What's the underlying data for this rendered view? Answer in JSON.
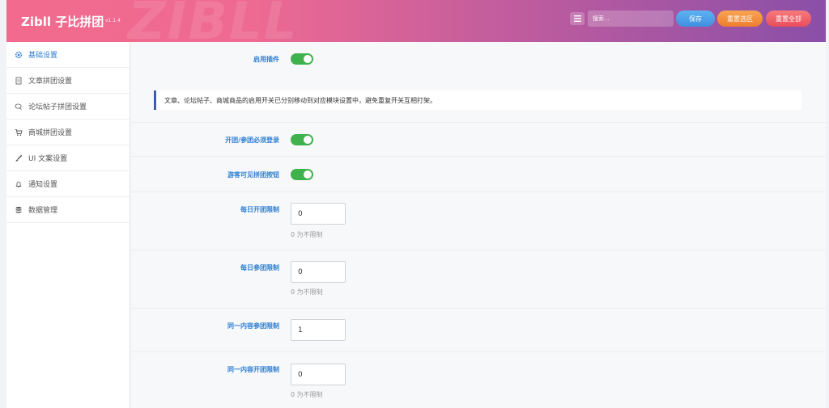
{
  "header": {
    "brand": "Zibll 子比拼团",
    "version": "v1.1.4",
    "watermark": "ZIBLL",
    "search_placeholder": "搜索...",
    "save_label": "保存",
    "reset_section_label": "重置选区",
    "reset_all_label": "重置全部"
  },
  "sidebar": {
    "items": [
      {
        "label": "基础设置",
        "icon": "gear-icon",
        "active": true
      },
      {
        "label": "文章拼团设置",
        "icon": "document-icon",
        "active": false
      },
      {
        "label": "论坛帖子拼团设置",
        "icon": "chat-icon",
        "active": false
      },
      {
        "label": "商城拼团设置",
        "icon": "cart-icon",
        "active": false
      },
      {
        "label": "UI 文案设置",
        "icon": "brush-icon",
        "active": false
      },
      {
        "label": "通知设置",
        "icon": "bell-icon",
        "active": false
      },
      {
        "label": "数据管理",
        "icon": "database-icon",
        "active": false
      }
    ]
  },
  "main": {
    "enable_plugin": {
      "label": "启用插件",
      "on": true
    },
    "notice": "文章、论坛帖子、商城商品的启用开关已分别移动到对应模块设置中，避免重复开关互相打架。",
    "login_required": {
      "label": "开团/参团必须登录",
      "on": true
    },
    "guest_visible": {
      "label": "游客可见拼团按钮",
      "on": true
    },
    "daily_open_limit": {
      "label": "每日开团限制",
      "value": "0",
      "hint": "0 为不限制"
    },
    "daily_join_limit": {
      "label": "每日参团限制",
      "value": "0",
      "hint": "0 为不限制"
    },
    "same_content_join_limit": {
      "label": "同一内容参团限制",
      "value": "1"
    },
    "same_content_open_limit": {
      "label": "同一内容开团限制",
      "value": "0",
      "hint": "0 为不限制"
    }
  },
  "colors": {
    "accent": "#2d7fd3",
    "toggle_on": "#3fb24d",
    "notice_border": "#3a5db0"
  }
}
